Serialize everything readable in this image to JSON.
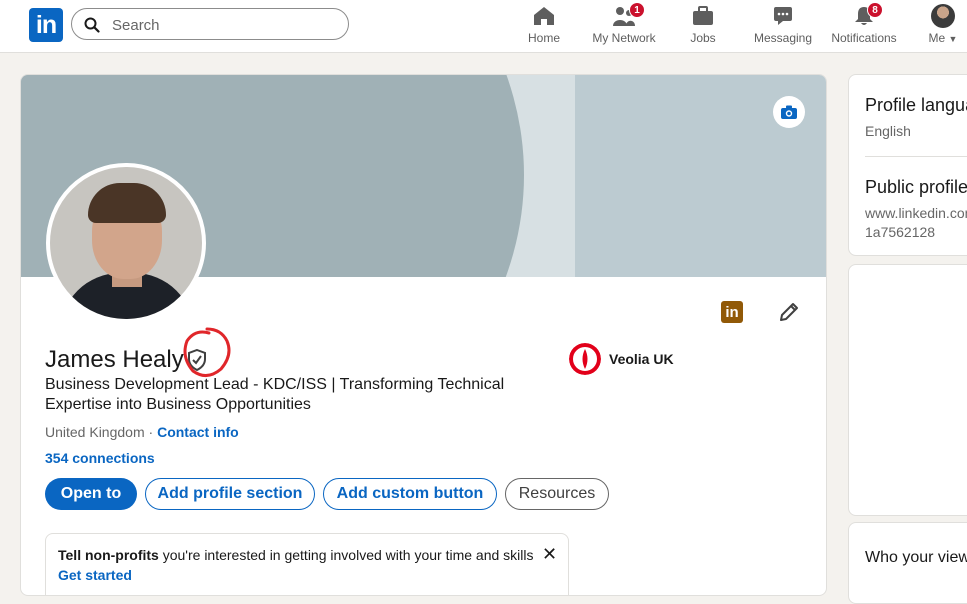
{
  "nav": {
    "logo": "in",
    "search_placeholder": "Search",
    "items": [
      {
        "label": "Home",
        "icon": "home-icon"
      },
      {
        "label": "My Network",
        "icon": "network-icon",
        "badge": "1"
      },
      {
        "label": "Jobs",
        "icon": "briefcase-icon"
      },
      {
        "label": "Messaging",
        "icon": "chat-icon"
      },
      {
        "label": "Notifications",
        "icon": "bell-icon",
        "badge": "8"
      },
      {
        "label": "Me",
        "icon": "avatar"
      }
    ]
  },
  "profile": {
    "name": "James Healy",
    "headline": "Business Development Lead - KDC/ISS | Transforming Technical Expertise into Business Opportunities",
    "location": "United Kingdom",
    "separator": "·",
    "contact_info": "Contact info",
    "connections": "354 connections",
    "company": "Veolia UK",
    "li_badge": "in"
  },
  "buttons": {
    "open_to": "Open to",
    "add_section": "Add profile section",
    "add_custom": "Add custom button",
    "resources": "Resources"
  },
  "notice": {
    "bold": "Tell non-profits",
    "rest": " you're interested in getting involved with your time and skills",
    "cta": "Get started",
    "close": "✕"
  },
  "right_rail": {
    "language_title": "Profile language",
    "language_value": "English",
    "public_title": "Public profile & URL",
    "public_url_1": "www.linkedin.com/in/james-healy-",
    "public_url_2": "1a7562128",
    "viewers_title": "Who your viewers also viewed"
  },
  "colors": {
    "brand": "#0a66c2",
    "badge_red": "#cb112d",
    "veolia_red": "#e2001a",
    "annotation_red": "#e0262a"
  }
}
